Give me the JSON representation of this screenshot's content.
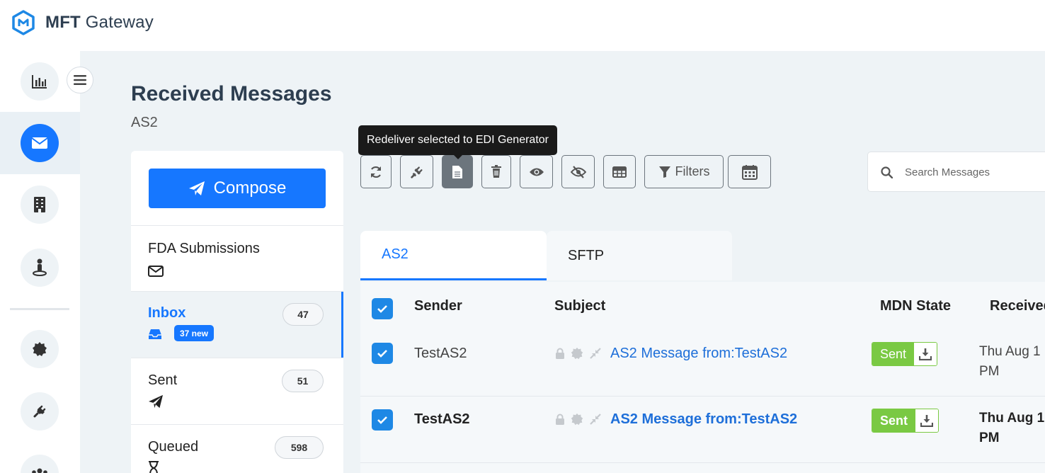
{
  "app": {
    "brand_bold": "MFT",
    "brand_rest": " Gateway"
  },
  "page": {
    "title": "Received Messages",
    "subtitle": "AS2"
  },
  "compose": {
    "label": "Compose"
  },
  "folders": [
    {
      "name": "FDA Submissions",
      "icon": "envelope-icon"
    },
    {
      "name": "Inbox",
      "count": "47",
      "badge": "37 new",
      "icon": "inbox-tray-icon"
    },
    {
      "name": "Sent",
      "count": "51",
      "icon": "paper-plane-icon"
    },
    {
      "name": "Queued",
      "count": "598",
      "icon": "hourglass-icon"
    }
  ],
  "toolbar": {
    "tooltip": "Redeliver selected to EDI Generator",
    "filters_label": "Filters",
    "buttons": [
      "refresh-icon",
      "plug-icon",
      "document-icon",
      "trash-icon",
      "eye-icon",
      "eye-slash-icon",
      "table-icon",
      "filter-icon",
      "calendar-icon"
    ]
  },
  "search": {
    "placeholder": "Search Messages"
  },
  "tabs": [
    {
      "label": "AS2",
      "active": true
    },
    {
      "label": "SFTP",
      "active": false
    }
  ],
  "table": {
    "headers": {
      "sender": "Sender",
      "subject": "Subject",
      "mdn": "MDN State",
      "received": "Received"
    },
    "rows": [
      {
        "sender": "TestAS2",
        "subject": "AS2 Message from:TestAS2",
        "mdn": "Sent",
        "received": "Thu Aug 1",
        "received_2": "PM",
        "unread": false
      },
      {
        "sender": "TestAS2",
        "subject": "AS2 Message from:TestAS2",
        "mdn": "Sent",
        "received": "Thu Aug 1",
        "received_2": "PM",
        "unread": true
      }
    ]
  },
  "colors": {
    "primary": "#1677ff",
    "success": "#7ac943",
    "dark_tooltip": "#1a1a1a",
    "secondary": "#6c757d"
  }
}
